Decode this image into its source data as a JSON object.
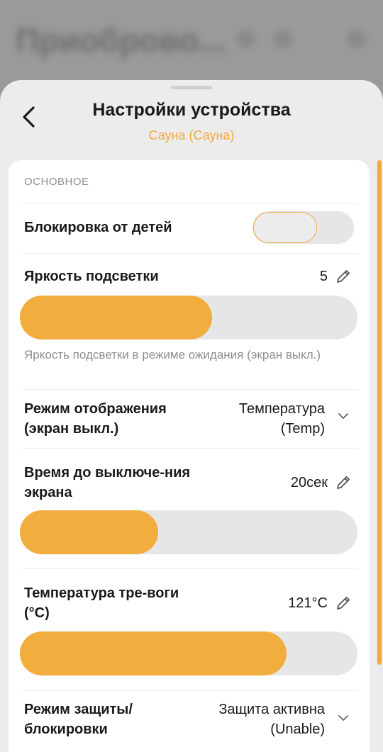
{
  "background": {
    "title": "Приоброво..."
  },
  "sheet": {
    "title": "Настройки устройства",
    "subtitle": "Сауна (Сауна)"
  },
  "section": {
    "label": "ОСНОВНОЕ"
  },
  "child_lock": {
    "label": "Блокировка от детей",
    "enabled": false
  },
  "brightness": {
    "label": "Яркость подсветки",
    "value": "5",
    "level_fraction": 0.57,
    "hint": "Яркость подсветки в режиме ожидания (экран выкл.)"
  },
  "display_mode": {
    "label": "Режим отображения (экран выкл.)",
    "value": "Температура (Temp)"
  },
  "screen_timeout": {
    "label": "Время до выключе-ния экрана",
    "value": "20сек",
    "level_fraction": 0.41
  },
  "alarm_temp": {
    "label": "Температура тре-воги (°C)",
    "value": "121°C",
    "level_fraction": 0.79
  },
  "protection_mode": {
    "label": "Режим защиты/ блокировки",
    "value": "Защита активна (Unable)"
  },
  "colors": {
    "accent": "#f2a93b",
    "track": "#e6e6e6"
  }
}
